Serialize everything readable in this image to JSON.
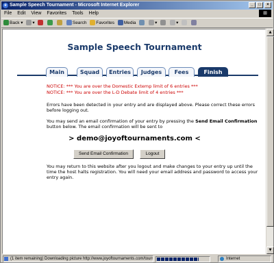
{
  "window": {
    "title": "Sample Speech Tournament - Microsoft Internet Explorer",
    "buttons": [
      "_",
      "□",
      "×"
    ]
  },
  "menu": [
    "File",
    "Edit",
    "View",
    "Favorites",
    "Tools",
    "Help"
  ],
  "toolbar": {
    "back": "Back",
    "search": "Search",
    "favorites": "Favorites",
    "media": "Media"
  },
  "page": {
    "title": "Sample Speech Tournament",
    "tabs": [
      "Main",
      "Squad",
      "Entries",
      "Judges",
      "Fees",
      "Finish"
    ],
    "active_tab": "Finish",
    "notice1": "NOTICE: *** You are over the Domestic Extemp limit of 6 entries ***",
    "notice2": "NOTICE: *** You are over the L-D Debate limit of 4 entries ***",
    "errors_text": "Errors have been detected in your entry and are displayed above. Please correct these errors before logging out.",
    "confirm_pre": "You may send an email confirmation of your entry by pressing the ",
    "confirm_bold": "Send Email Confirmation",
    "confirm_post": " button below. The email confirmation will be sent to",
    "email_line": "> demo@joyoftournaments.com <",
    "send_button": "Send Email Confirmation",
    "logout_button": "Logout",
    "return_text": "You may return to this website after you logout and make changes to your entry up until the time the host halts registration. You will need your email address and password to access your entry again."
  },
  "status": {
    "message": "(1 item remaining) Downloading picture http://www.joyoftournaments.com/tourr",
    "zone": "Internet",
    "progress": 0.8
  },
  "colors": {
    "accent": "#1a3a6a",
    "notice": "#cc0000"
  }
}
